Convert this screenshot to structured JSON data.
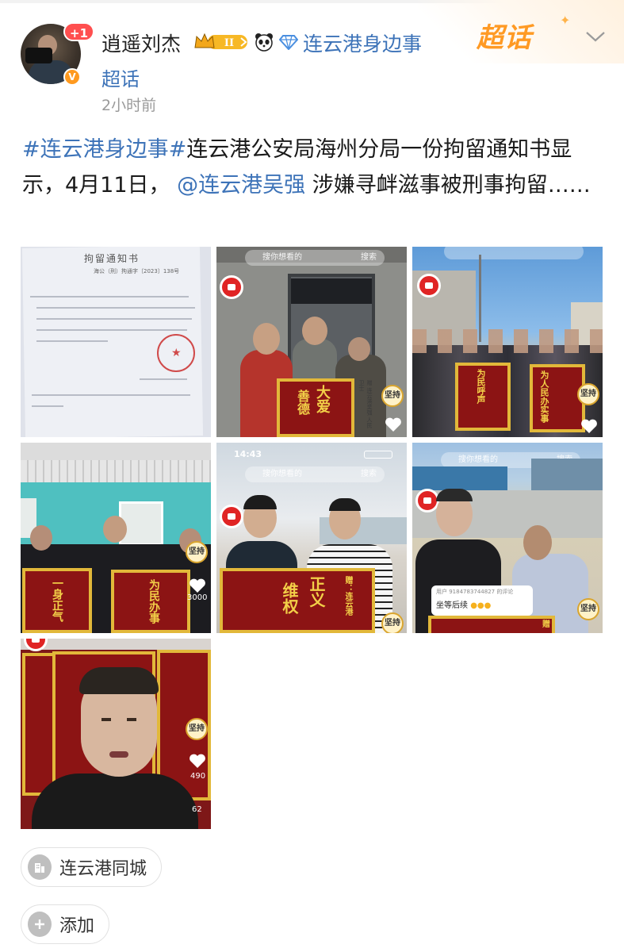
{
  "post": {
    "author": {
      "name": "逍遥刘杰",
      "notification_count": "+1",
      "level_badge": "II",
      "verified_icon": "v-verified-icon"
    },
    "topic": {
      "name": "连云港身边事",
      "type": "超话"
    },
    "timestamp": "2小时前",
    "chaohua_logo": "超话",
    "text": {
      "tag": "#连云港身边事#",
      "part1": "连云港公安局海州分局一份拘留通知书显示，4月11日，",
      "mention": "@连云港吴强",
      "part2": " 涉嫌寻衅滋事被刑事拘留……"
    }
  },
  "images": {
    "doc": {
      "title": "拘留通知书",
      "number": "海公（刑）拘通字〔2023〕138号"
    },
    "p2": {
      "search": "搜你想看的",
      "search_btn": "搜索",
      "banner_a": "大爱",
      "banner_b": "善德",
      "banner_side": "赠 连云港吴强 人民卫士"
    },
    "p3": {
      "banner_a": "为民呼声",
      "banner_b": "为人民办实事"
    },
    "p4": {
      "count": "3000",
      "banner_a": "一身正气",
      "banner_b": "为民办事"
    },
    "p5": {
      "time": "14:43",
      "search": "搜你想看的",
      "search_btn": "搜索",
      "banner_a": "正义",
      "banner_b": "维权",
      "banner_from": "赠：连云港"
    },
    "p6": {
      "search": "搜你想看的",
      "search_btn": "搜索",
      "comment_user": "用户 9184783744827 的评论",
      "comment_text": "坐等后续",
      "banner": "赠"
    },
    "p7": {
      "likes": "490",
      "comments": "62"
    }
  },
  "footer": {
    "city_chip": "连云港同城",
    "add_chip": "添加"
  },
  "colors": {
    "link": "#3d73b8",
    "accent": "#ff9a24",
    "banner_red": "#8c1414",
    "banner_gold": "#e2b83a"
  }
}
